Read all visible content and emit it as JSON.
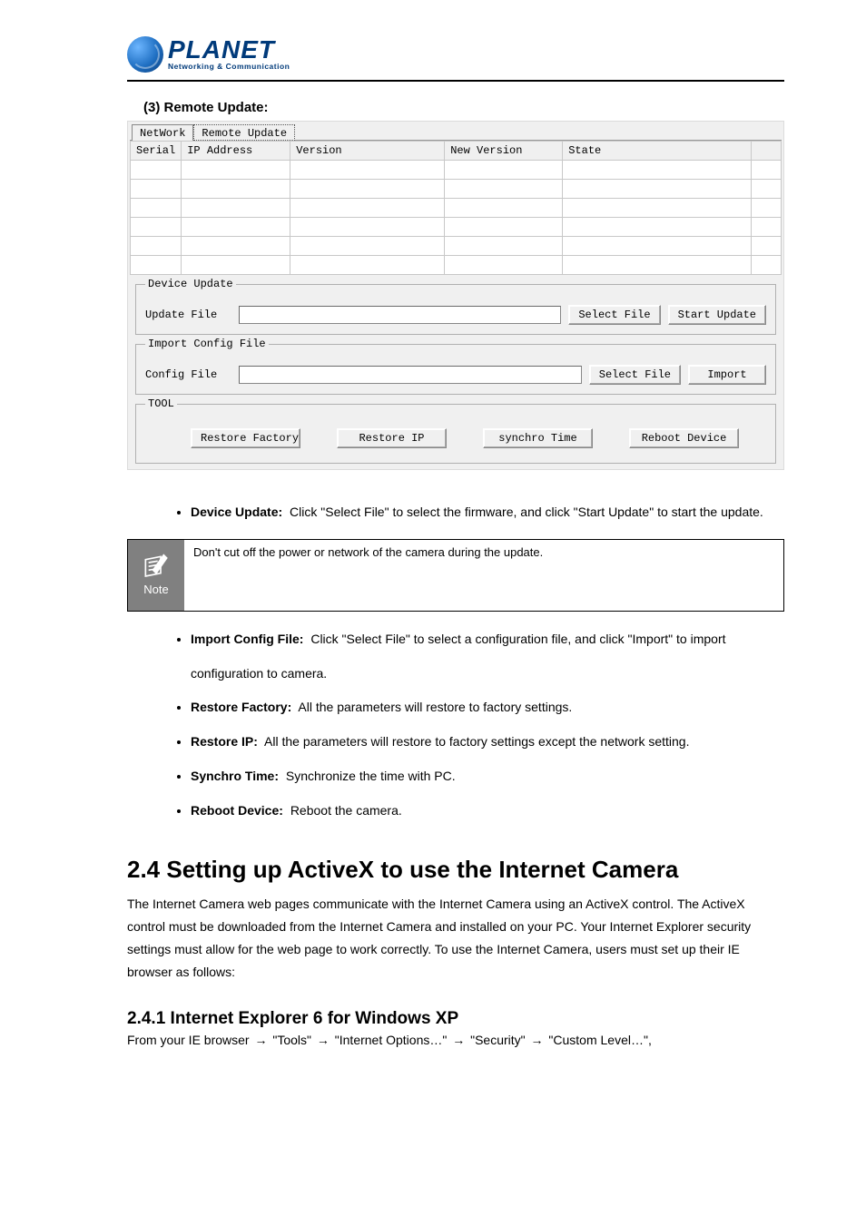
{
  "logo": {
    "main": "PLANET",
    "sub": "Networking & Communication"
  },
  "section3": {
    "title": "(3) Remote Update:",
    "tabs": {
      "network": "NetWork",
      "remote_update": "Remote Update"
    },
    "table_headers": {
      "serial": "Serial",
      "ip": "IP Address",
      "version": "Version",
      "new_version": "New Version",
      "state": "State"
    },
    "fieldsets": {
      "device_update": {
        "legend": "Device Update",
        "label": "Update File",
        "select": "Select File",
        "start": "Start Update"
      },
      "import_config": {
        "legend": "Import Config File",
        "label": "Config File",
        "select": "Select File",
        "import": "Import"
      },
      "tool": {
        "legend": "TOOL",
        "restore_factory": "Restore Factory",
        "restore_ip": "Restore IP",
        "synchro_time": "synchro Time",
        "reboot": "Reboot Device"
      }
    }
  },
  "bullets": {
    "device_update": {
      "label": "Device Update:",
      "desc": "Click \"Select File\" to select the firmware, and click \"Start Update\" to start the update."
    },
    "import_config": {
      "label": "Import Config File:",
      "desc": "Click \"Select File\" to select a configuration file, and click \"Import\" to import configuration to camera."
    },
    "restore_factory": {
      "label": "Restore Factory:",
      "desc": "All the parameters will restore to factory settings."
    },
    "restore_ip": {
      "label": "Restore IP:",
      "desc": "All the parameters will restore to factory settings except the network setting."
    },
    "synchro_time": {
      "label": "Synchro Time:",
      "desc": "Synchronize the time with PC."
    },
    "reboot": {
      "label": "Reboot Device:",
      "desc": "Reboot the camera."
    }
  },
  "note": {
    "word": "Note",
    "body": "Don't cut off the power or network of the camera during the update."
  },
  "section24": {
    "heading": "2.4 Setting up ActiveX to use the Internet Camera",
    "desc": "The Internet Camera web pages communicate with the Internet Camera using an ActiveX control. The ActiveX control must be downloaded from the Internet Camera and installed on your PC. Your Internet Explorer security settings must allow for the web page to work correctly. To use the Internet Camera, users must set up their IE browser as follows:"
  },
  "section241": {
    "heading": "2.4.1 Internet Explorer 6 for Windows XP",
    "path": [
      "From your IE browser ",
      " \"Tools\" ",
      " \"Internet Options…\" ",
      " \"Security\" ",
      " \"Custom Level…\","
    ]
  }
}
